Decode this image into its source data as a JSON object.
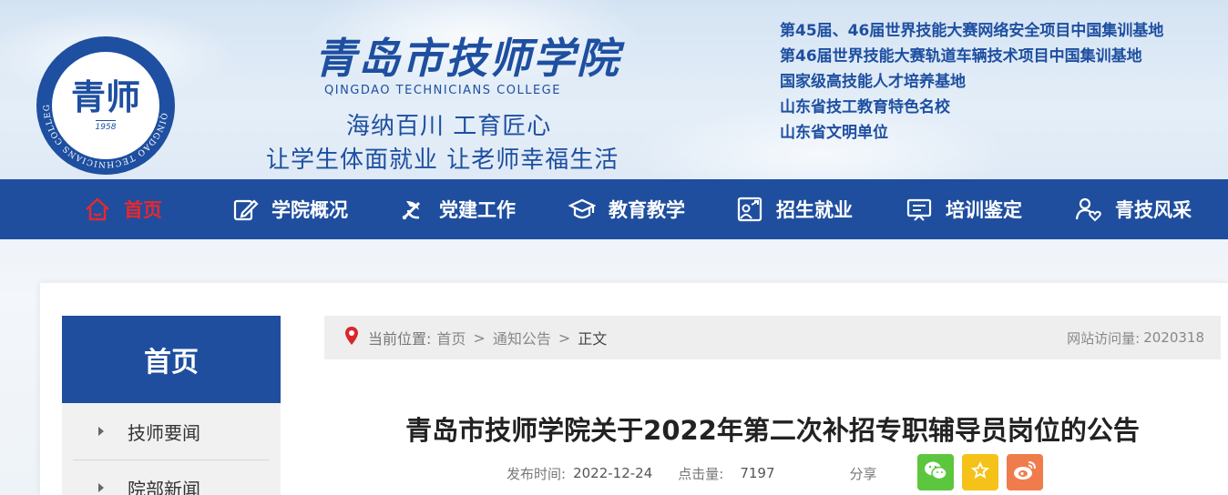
{
  "header": {
    "logo_mark": "青师",
    "logo_year": "1958",
    "logo_ring_text": "QINGDAO TECHNICIANS COLLEGE",
    "college_name_cn": "青岛市技师学院",
    "college_name_en": "QINGDAO TECHNICIANS COLLEGE",
    "motto_line1": "海纳百川  工育匠心",
    "motto_line2": "让学生体面就业  让老师幸福生活",
    "honors": [
      "第45届、46届世界技能大赛网络安全项目中国集训基地",
      "第46届世界技能大赛轨道车辆技术项目中国集训基地",
      "国家级高技能人才培养基地",
      "山东省技工教育特色名校",
      "山东省文明单位"
    ]
  },
  "nav": {
    "items": [
      {
        "label": "首页",
        "icon": "home-icon",
        "active": true
      },
      {
        "label": "学院概况",
        "icon": "edit-icon",
        "active": false
      },
      {
        "label": "党建工作",
        "icon": "party-emblem-icon",
        "active": false
      },
      {
        "label": "教育教学",
        "icon": "graduation-cap-icon",
        "active": false
      },
      {
        "label": "招生就业",
        "icon": "recruit-icon",
        "active": false
      },
      {
        "label": "培训鉴定",
        "icon": "presentation-board-icon",
        "active": false
      },
      {
        "label": "青技风采",
        "icon": "users-heart-icon",
        "active": false
      }
    ],
    "colors": {
      "background": "#1f4e9e",
      "active": "#e8282d",
      "text": "#ffffff"
    }
  },
  "sidebar": {
    "title": "首页",
    "items": [
      "技师要闻",
      "院部新闻"
    ]
  },
  "breadcrumb": {
    "prefix": "当前位置:",
    "items": [
      "首页",
      "通知公告",
      "正文"
    ],
    "visits_label": "网站访问量:",
    "visits_value": "2020318"
  },
  "article": {
    "title": "青岛市技师学院关于2022年第二次补招专职辅导员岗位的公告",
    "publish_label": "发布时间:",
    "publish_date": "2022-12-24",
    "clicks_label": "点击量:",
    "clicks_value": "7197",
    "share_label": "分享",
    "share_buttons": [
      {
        "icon": "wechat-icon",
        "color": "#5cc63f"
      },
      {
        "icon": "star-icon",
        "color": "#f5c21a"
      },
      {
        "icon": "weibo-icon",
        "color": "#f07c4c"
      }
    ]
  }
}
